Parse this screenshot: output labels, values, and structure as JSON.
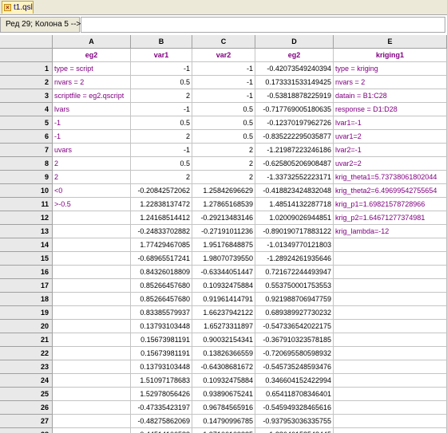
{
  "tab": {
    "filename": "t1.qsl",
    "close_glyph": "×"
  },
  "status": {
    "position_text": "Ред 29; Колона 5 -->"
  },
  "columns": [
    "",
    "A",
    "B",
    "C",
    "D",
    "E"
  ],
  "column_names": [
    "eg2",
    "var1",
    "var2",
    "eg2",
    "kriging1"
  ],
  "rows": [
    [
      "1",
      "type = script",
      "-1",
      "-1",
      "-0.42073549240394",
      "type = kriging"
    ],
    [
      "2",
      "nvars = 2",
      "0.5",
      "-1",
      "0.173331533149425",
      "nvars = 2"
    ],
    [
      "3",
      "scriptfile = eg2.qscript",
      "2",
      "-1",
      "-0.53818878225919",
      "datain = B1:C28"
    ],
    [
      "4",
      "lvars",
      "-1",
      "0.5",
      "-0.717769005180635",
      "response = D1:D28"
    ],
    [
      "5",
      "-1",
      "0.5",
      "0.5",
      "-0.12370197962726",
      "lvar1=-1"
    ],
    [
      "6",
      "-1",
      "2",
      "0.5",
      "-0.835222295035877",
      "uvar1=2"
    ],
    [
      "7",
      "uvars",
      "-1",
      "2",
      "-1.21987223246186",
      "lvar2=-1"
    ],
    [
      "8",
      "2",
      "0.5",
      "2",
      "-0.625805206908487",
      "uvar2=2"
    ],
    [
      "9",
      "2",
      "2",
      "2",
      "-1.33732552223171",
      "krig_theta1=5.73738061802044"
    ],
    [
      "10",
      "<0",
      "-0.20842572062",
      "1.25842696629",
      "-0.418823424832048",
      "krig_theta2=6.49699542755654"
    ],
    [
      "11",
      ">-0.5",
      "1.22838137472",
      "1.27865168539",
      "1.48514132287718",
      "krig_p1=1.69821578728966"
    ],
    [
      "12",
      "",
      "1.24168514412",
      "-0.29213483146",
      "1.02009026944851",
      "krig_p2=1.64671277374981"
    ],
    [
      "13",
      "",
      "-0.24833702882",
      "-0.27191011236",
      "-0.890190717883122",
      "krig_lambda=-12"
    ],
    [
      "14",
      "",
      "1.77429467085",
      "1.95176848875",
      "-1.01349770121803",
      ""
    ],
    [
      "15",
      "",
      "-0.68965517241",
      "1.98070739550",
      "-1.28924261935646",
      ""
    ],
    [
      "16",
      "",
      "0.84326018809",
      "-0.63344051447",
      "0.721672244493947",
      ""
    ],
    [
      "17",
      "",
      "0.85266457680",
      "0.10932475884",
      "0.553750001753553",
      ""
    ],
    [
      "18",
      "",
      "0.85266457680",
      "0.91961414791",
      "0.921988706947759",
      ""
    ],
    [
      "19",
      "",
      "0.83385579937",
      "1.66237942122",
      "0.689389927730232",
      ""
    ],
    [
      "20",
      "",
      "0.13793103448",
      "1.65273311897",
      "-0.547336542022175",
      ""
    ],
    [
      "21",
      "",
      "0.15673981191",
      "0.90032154341",
      "-0.367910323578185",
      ""
    ],
    [
      "22",
      "",
      "0.15673981191",
      "0.13826366559",
      "-0.720695580598932",
      ""
    ],
    [
      "23",
      "",
      "0.13793103448",
      "-0.64308681672",
      "-0.545735248593476",
      ""
    ],
    [
      "24",
      "",
      "1.51097178683",
      "0.10932475884",
      "0.346604152422994",
      ""
    ],
    [
      "25",
      "",
      "1.52978056426",
      "0.93890675241",
      "0.654118708346401",
      ""
    ],
    [
      "26",
      "",
      "-0.47335423197",
      "0.96784565916",
      "-0.545949328465616",
      ""
    ],
    [
      "27",
      "",
      "-0.48275862069",
      "0.14790996785",
      "-0.937953036335755",
      ""
    ],
    [
      "28",
      "",
      "-0.44514106583",
      "1.97106109325",
      "-1.28646158548445",
      ""
    ]
  ],
  "colors": {
    "header_bg": "#e9e9e9",
    "text_label": "#800080",
    "tab_bg": "#fff3c0"
  }
}
